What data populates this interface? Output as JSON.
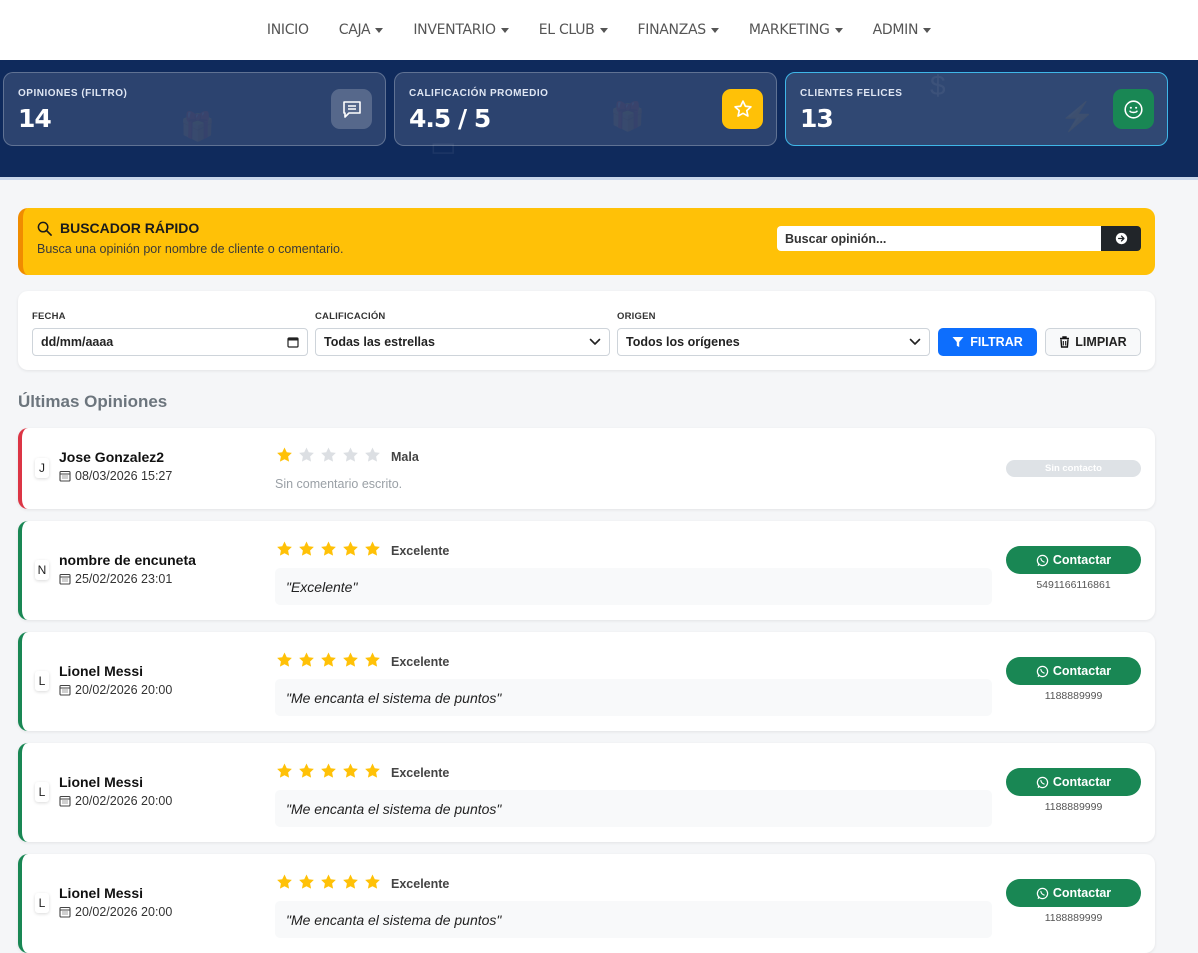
{
  "nav": {
    "items": [
      {
        "label": "INICIO",
        "dropdown": false
      },
      {
        "label": "CAJA",
        "dropdown": true
      },
      {
        "label": "INVENTARIO",
        "dropdown": true
      },
      {
        "label": "EL CLUB",
        "dropdown": true
      },
      {
        "label": "FINANZAS",
        "dropdown": true
      },
      {
        "label": "MARKETING",
        "dropdown": true
      },
      {
        "label": "ADMIN",
        "dropdown": true
      }
    ]
  },
  "stats": [
    {
      "label": "OPINIONES (FILTRO)",
      "value": "14",
      "icon": "chat-icon"
    },
    {
      "label": "CALIFICACIÓN PROMEDIO",
      "value": "4.5 / 5",
      "icon": "star-icon"
    },
    {
      "label": "CLIENTES FELICES",
      "value": "13",
      "icon": "smile-icon"
    }
  ],
  "search": {
    "title": "BUSCADOR RÁPIDO",
    "subtitle": "Busca una opinión por nombre de cliente o comentario.",
    "placeholder": "Buscar opinión..."
  },
  "filters": {
    "date_label": "FECHA",
    "date_placeholder": "dd/mm/aaaa",
    "rating_label": "CALIFICACIÓN",
    "rating_value": "Todas las estrellas",
    "origin_label": "ORIGEN",
    "origin_value": "Todos los orígenes",
    "filter_button": "FILTRAR",
    "clear_button": "LIMPIAR"
  },
  "section_title": "Últimas Opiniones",
  "contact_label": "Contactar",
  "no_contact_label": "Sin contacto",
  "empty_comment": "Sin comentario escrito.",
  "colors": {
    "accent_blue": "#0d6efd",
    "success": "#198754",
    "warning": "#ffc107",
    "danger": "#dc3545",
    "hero": "#0f2a5c"
  },
  "reviews": [
    {
      "initial": "J",
      "name": "Jose Gonzalez2",
      "date": "08/03/2026 15:27",
      "stars": 1,
      "rating": "Mala",
      "comment": "",
      "phone": "",
      "has_contact": false
    },
    {
      "initial": "N",
      "name": "nombre de encuneta",
      "date": "25/02/2026 23:01",
      "stars": 5,
      "rating": "Excelente",
      "comment": "\"Excelente\"",
      "phone": "5491166116861",
      "has_contact": true
    },
    {
      "initial": "L",
      "name": "Lionel Messi",
      "date": "20/02/2026 20:00",
      "stars": 5,
      "rating": "Excelente",
      "comment": "\"Me encanta el sistema de puntos\"",
      "phone": "1188889999",
      "has_contact": true
    },
    {
      "initial": "L",
      "name": "Lionel Messi",
      "date": "20/02/2026 20:00",
      "stars": 5,
      "rating": "Excelente",
      "comment": "\"Me encanta el sistema de puntos\"",
      "phone": "1188889999",
      "has_contact": true
    },
    {
      "initial": "L",
      "name": "Lionel Messi",
      "date": "20/02/2026 20:00",
      "stars": 5,
      "rating": "Excelente",
      "comment": "\"Me encanta el sistema de puntos\"",
      "phone": "1188889999",
      "has_contact": true
    }
  ]
}
